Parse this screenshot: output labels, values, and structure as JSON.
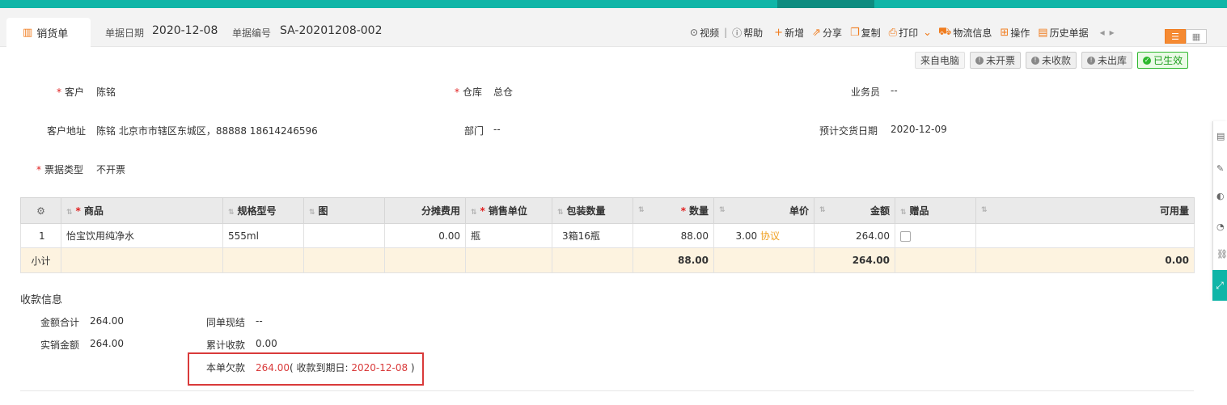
{
  "tab": {
    "label": "销货单"
  },
  "header": {
    "date_label": "单据日期",
    "date_value": "2020-12-08",
    "no_label": "单据编号",
    "no_value": "SA-20201208-002"
  },
  "toolbar": {
    "video": "视频",
    "help": "帮助",
    "add": "新增",
    "share": "分享",
    "copy": "复制",
    "print": "打印",
    "logistics": "物流信息",
    "operate": "操作",
    "history": "历史单据"
  },
  "badges": {
    "source": "来自电脑",
    "invoice": "未开票",
    "receipt": "未收款",
    "outbound": "未出库",
    "effective": "已生效"
  },
  "form": {
    "customer_label": "客户",
    "customer_value": "陈铭",
    "warehouse_label": "仓库",
    "warehouse_value": "总仓",
    "salesperson_label": "业务员",
    "salesperson_value": "--",
    "address_label": "客户地址",
    "address_value": "陈铭 北京市市辖区东城区，88888 18614246596",
    "dept_label": "部门",
    "dept_value": "--",
    "delivery_label": "预计交货日期",
    "delivery_value": "2020-12-09",
    "invoice_type_label": "票据类型",
    "invoice_type_value": "不开票"
  },
  "table": {
    "headers": {
      "product": "商品",
      "spec": "规格型号",
      "image": "图",
      "shared_cost": "分摊费用",
      "unit": "销售单位",
      "pack": "包装数量",
      "qty": "数量",
      "price": "单价",
      "amount": "金额",
      "gift": "赠品",
      "available": "可用量"
    },
    "rows": [
      {
        "index": "1",
        "product": "怡宝饮用纯净水",
        "spec": "555ml",
        "shared_cost": "0.00",
        "unit": "瓶",
        "pack": "3箱16瓶",
        "qty": "88.00",
        "price": "3.00",
        "price_tag": "协议",
        "amount": "264.00"
      }
    ],
    "subtotal": {
      "label": "小计",
      "qty": "88.00",
      "amount": "264.00",
      "available": "0.00"
    }
  },
  "payment": {
    "title": "收款信息",
    "total_label": "金额合计",
    "total_value": "264.00",
    "actual_label": "实销金额",
    "actual_value": "264.00",
    "settle_label": "同单现结",
    "settle_value": "--",
    "cumulative_label": "累计收款",
    "cumulative_value": "0.00",
    "due_label": "本单欠款",
    "due_value": "264.00",
    "due_open": "( 收款到期日: ",
    "due_date": "2020-12-08",
    "due_close": " )"
  },
  "colors": {
    "accent": "#0fb5a7",
    "orange": "#f07c1e",
    "red": "#d93a3a",
    "subtotal_bg": "#fdf3e0"
  }
}
